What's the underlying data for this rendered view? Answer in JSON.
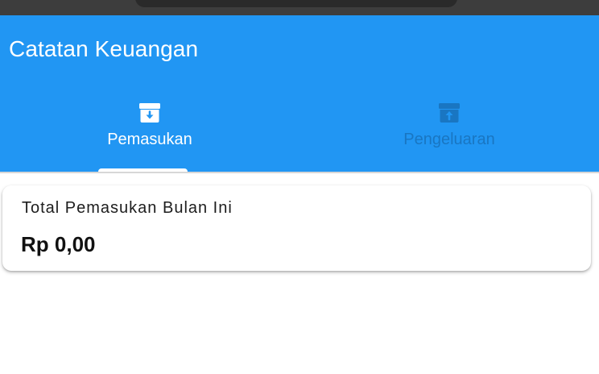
{
  "app": {
    "title": "Catatan Keuangan"
  },
  "tabs": [
    {
      "label": "Pemasukan",
      "icon": "archive-down-icon",
      "selected": true
    },
    {
      "label": "Pengeluaran",
      "icon": "archive-up-icon",
      "selected": false
    }
  ],
  "summary": {
    "title": "Total Pemasukan Bulan Ini",
    "amount": "Rp 0,00"
  },
  "colors": {
    "primary": "#2196f3",
    "inactive_tab": "#1976c2",
    "active_tab": "#ffffff"
  }
}
